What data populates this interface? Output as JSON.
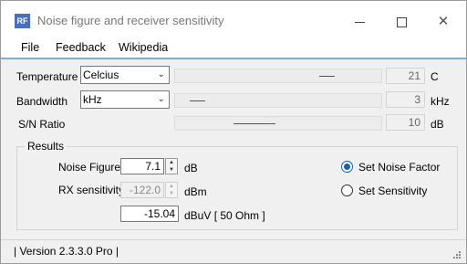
{
  "window": {
    "app_icon_text": "RF",
    "title": "Noise figure and receiver sensitivity"
  },
  "menu": {
    "items": [
      "File",
      "Feedback",
      "Wikipedia"
    ]
  },
  "temperature": {
    "label": "Temperature",
    "unit_select": "Celcius",
    "value": "21",
    "unit": "C"
  },
  "bandwidth": {
    "label": "Bandwidth",
    "unit_select": "kHz",
    "value": "3",
    "unit": "kHz"
  },
  "snr": {
    "label": "S/N Ratio",
    "value": "10",
    "unit": "dB"
  },
  "results": {
    "title": "Results",
    "noise_figure": {
      "label": "Noise Figure",
      "value": "7.1",
      "unit": "dB"
    },
    "rx_sensitivity": {
      "label": "RX sensitivity",
      "value": "-122.0",
      "unit": "dBm"
    },
    "dbuv": {
      "value": "-15.04",
      "unit": "dBuV [ 50 Ohm ]"
    },
    "options": [
      {
        "label": "Set Noise Factor",
        "checked": true
      },
      {
        "label": "Set Sensitivity",
        "checked": false
      }
    ]
  },
  "status": {
    "text": "| Version 2.3.3.0 Pro |"
  }
}
